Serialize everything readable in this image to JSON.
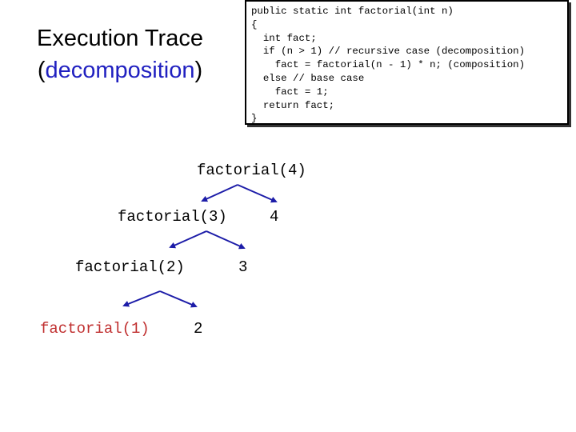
{
  "title": {
    "line1": "Execution Trace",
    "open_paren": "(",
    "highlight": "decomposition",
    "close_paren": ")"
  },
  "code": {
    "lines": [
      "public static int factorial(int n)",
      "{",
      "  int fact;",
      "  if (n > 1) // recursive case (decomposition)",
      "    fact = factorial(n - 1) * n; (composition)",
      "  else // base case",
      "    fact = 1;",
      "  return fact;",
      "}"
    ]
  },
  "trace": {
    "nodes": [
      {
        "label": "factorial(4)"
      },
      {
        "label": "factorial(3)"
      },
      {
        "label": "4"
      },
      {
        "label": "factorial(2)"
      },
      {
        "label": "3"
      },
      {
        "label": "factorial(1)"
      },
      {
        "label": "2"
      }
    ]
  },
  "colors": {
    "arrow": "#1c1ca8",
    "highlight": "#2020c0",
    "base_case": "#c03030"
  }
}
